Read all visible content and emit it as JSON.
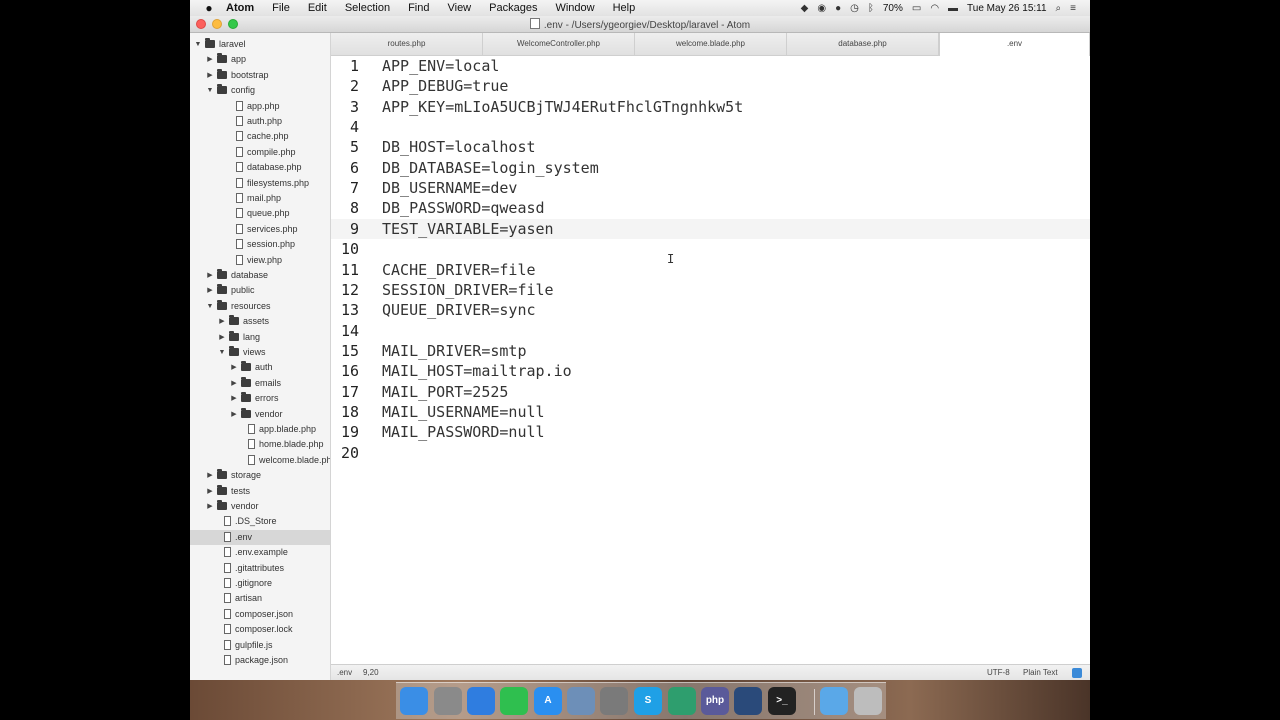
{
  "menubar": {
    "items": [
      "Atom",
      "File",
      "Edit",
      "Selection",
      "Find",
      "View",
      "Packages",
      "Window",
      "Help"
    ],
    "battery": "70%",
    "clock": "Tue May 26  15:11"
  },
  "window": {
    "title": ".env - /Users/ygeorgiev/Desktop/laravel - Atom"
  },
  "tree": [
    {
      "label": "laravel",
      "kind": "folder",
      "depth": 0,
      "expanded": true
    },
    {
      "label": "app",
      "kind": "folder",
      "depth": 1,
      "expanded": false
    },
    {
      "label": "bootstrap",
      "kind": "folder",
      "depth": 1,
      "expanded": false
    },
    {
      "label": "config",
      "kind": "folder",
      "depth": 1,
      "expanded": true
    },
    {
      "label": "app.php",
      "kind": "file",
      "depth": 2
    },
    {
      "label": "auth.php",
      "kind": "file",
      "depth": 2
    },
    {
      "label": "cache.php",
      "kind": "file",
      "depth": 2
    },
    {
      "label": "compile.php",
      "kind": "file",
      "depth": 2
    },
    {
      "label": "database.php",
      "kind": "file",
      "depth": 2
    },
    {
      "label": "filesystems.php",
      "kind": "file",
      "depth": 2
    },
    {
      "label": "mail.php",
      "kind": "file",
      "depth": 2
    },
    {
      "label": "queue.php",
      "kind": "file",
      "depth": 2
    },
    {
      "label": "services.php",
      "kind": "file",
      "depth": 2
    },
    {
      "label": "session.php",
      "kind": "file",
      "depth": 2
    },
    {
      "label": "view.php",
      "kind": "file",
      "depth": 2
    },
    {
      "label": "database",
      "kind": "folder",
      "depth": 1,
      "expanded": false
    },
    {
      "label": "public",
      "kind": "folder",
      "depth": 1,
      "expanded": false
    },
    {
      "label": "resources",
      "kind": "folder",
      "depth": 1,
      "expanded": true
    },
    {
      "label": "assets",
      "kind": "folder",
      "depth": 2,
      "expanded": false
    },
    {
      "label": "lang",
      "kind": "folder",
      "depth": 2,
      "expanded": false
    },
    {
      "label": "views",
      "kind": "folder",
      "depth": 2,
      "expanded": true
    },
    {
      "label": "auth",
      "kind": "folder",
      "depth": 3,
      "expanded": false
    },
    {
      "label": "emails",
      "kind": "folder",
      "depth": 3,
      "expanded": false
    },
    {
      "label": "errors",
      "kind": "folder",
      "depth": 3,
      "expanded": false
    },
    {
      "label": "vendor",
      "kind": "folder",
      "depth": 3,
      "expanded": false
    },
    {
      "label": "app.blade.php",
      "kind": "file",
      "depth": 3
    },
    {
      "label": "home.blade.php",
      "kind": "file",
      "depth": 3
    },
    {
      "label": "welcome.blade.php",
      "kind": "file",
      "depth": 3
    },
    {
      "label": "storage",
      "kind": "folder",
      "depth": 1,
      "expanded": false
    },
    {
      "label": "tests",
      "kind": "folder",
      "depth": 1,
      "expanded": false
    },
    {
      "label": "vendor",
      "kind": "folder",
      "depth": 1,
      "expanded": false
    },
    {
      "label": ".DS_Store",
      "kind": "file",
      "depth": 1
    },
    {
      "label": ".env",
      "kind": "file",
      "depth": 1,
      "selected": true
    },
    {
      "label": ".env.example",
      "kind": "file",
      "depth": 1
    },
    {
      "label": ".gitattributes",
      "kind": "file",
      "depth": 1
    },
    {
      "label": ".gitignore",
      "kind": "file",
      "depth": 1
    },
    {
      "label": "artisan",
      "kind": "file",
      "depth": 1
    },
    {
      "label": "composer.json",
      "kind": "file",
      "depth": 1
    },
    {
      "label": "composer.lock",
      "kind": "file",
      "depth": 1
    },
    {
      "label": "gulpfile.js",
      "kind": "file",
      "depth": 1
    },
    {
      "label": "package.json",
      "kind": "file",
      "depth": 1
    }
  ],
  "tabs": [
    {
      "label": "routes.php",
      "active": false
    },
    {
      "label": "WelcomeController.php",
      "active": false
    },
    {
      "label": "welcome.blade.php",
      "active": false
    },
    {
      "label": "database.php",
      "active": false
    },
    {
      "label": ".env",
      "active": true
    }
  ],
  "editor": {
    "cursor_line": 9,
    "lines": [
      "APP_ENV=local",
      "APP_DEBUG=true",
      "APP_KEY=mLIoA5UCBjTWJ4ERutFhclGTngnhkw5t",
      "",
      "DB_HOST=localhost",
      "DB_DATABASE=login_system",
      "DB_USERNAME=dev",
      "DB_PASSWORD=qweasd",
      "TEST_VARIABLE=yasen",
      "",
      "CACHE_DRIVER=file",
      "SESSION_DRIVER=file",
      "QUEUE_DRIVER=sync",
      "",
      "MAIL_DRIVER=smtp",
      "MAIL_HOST=mailtrap.io",
      "MAIL_PORT=2525",
      "MAIL_USERNAME=null",
      "MAIL_PASSWORD=null",
      ""
    ]
  },
  "statusbar": {
    "file": ".env",
    "position": "9,20",
    "encoding": "UTF-8",
    "grammar": "Plain Text"
  },
  "dock": {
    "items": [
      {
        "name": "finder",
        "color": "#3a8ee6",
        "glyph": ""
      },
      {
        "name": "launchpad",
        "color": "#8a8a8a",
        "glyph": ""
      },
      {
        "name": "safari",
        "color": "#2f7de0",
        "glyph": ""
      },
      {
        "name": "spotify",
        "color": "#2fbf4f",
        "glyph": ""
      },
      {
        "name": "app-store",
        "color": "#2a8ff0",
        "glyph": "A"
      },
      {
        "name": "preview",
        "color": "#6d8fb8",
        "glyph": ""
      },
      {
        "name": "system-preferences",
        "color": "#7a7a7a",
        "glyph": ""
      },
      {
        "name": "skype",
        "color": "#1fa0e6",
        "glyph": "S"
      },
      {
        "name": "atom",
        "color": "#2e9e6e",
        "glyph": ""
      },
      {
        "name": "php-storm",
        "color": "#5a5a9a",
        "glyph": "php"
      },
      {
        "name": "quicktime",
        "color": "#2a4a7a",
        "glyph": ""
      },
      {
        "name": "terminal",
        "color": "#222222",
        "glyph": ">_"
      },
      {
        "name": "downloads-folder",
        "color": "#5aa8e8",
        "glyph": ""
      },
      {
        "name": "trash",
        "color": "#bdbdbd",
        "glyph": ""
      }
    ]
  }
}
